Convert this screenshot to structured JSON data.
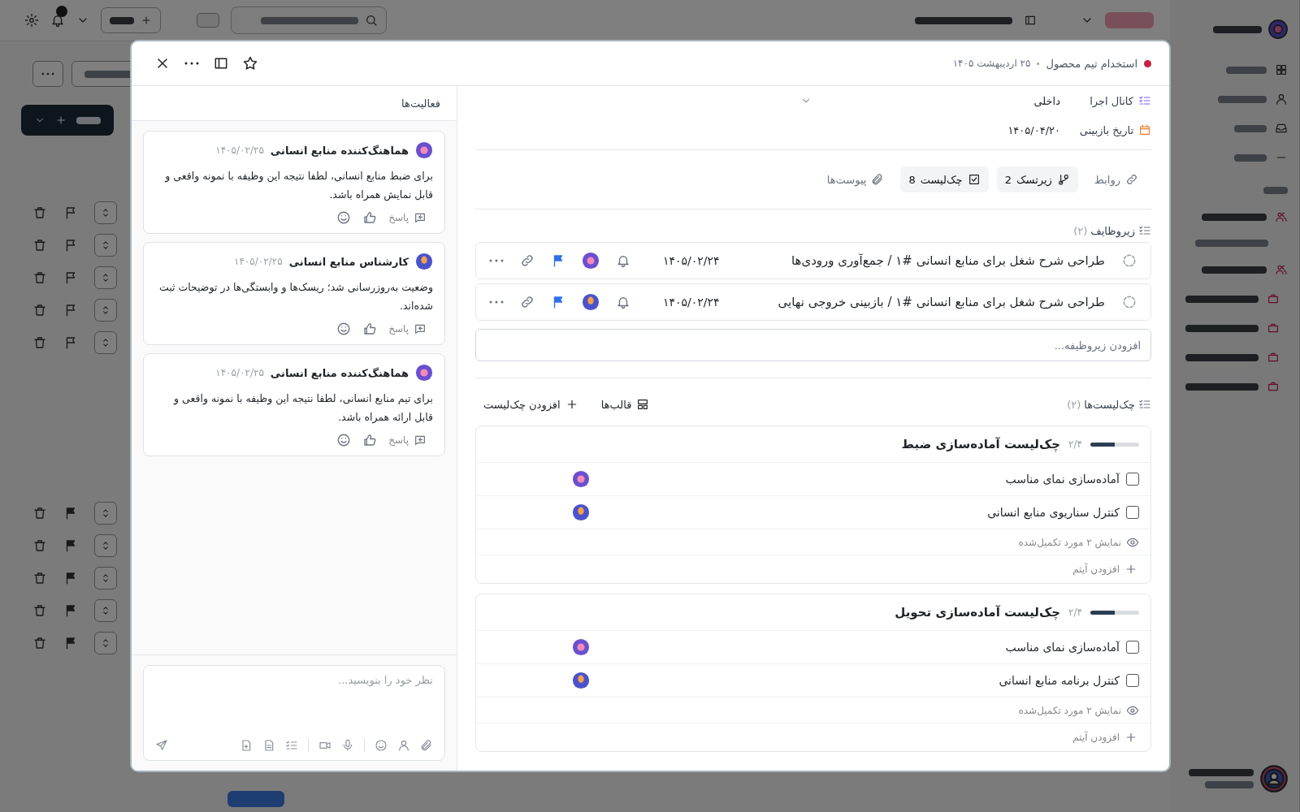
{
  "background": {
    "rows": [
      {
        "flagged": false
      },
      {
        "flagged": false
      },
      {
        "flagged": false
      },
      {
        "flagged": false
      },
      {
        "flagged": false
      },
      {
        "flagged": true
      },
      {
        "flagged": true
      },
      {
        "flagged": true
      },
      {
        "flagged": true
      },
      {
        "flagged": true
      }
    ]
  },
  "modal": {
    "header": {
      "project": "استخدام تیم محصول",
      "date": "۲۵ اردیبهشت ۱۴۰۵"
    },
    "fields": [
      {
        "kind": "channel",
        "label": "کانال اجرا",
        "value": "داخلی"
      },
      {
        "kind": "date",
        "label": "تاریخ بازبینی",
        "value": "۱۴۰۵/۰۴/۲۰"
      }
    ],
    "tabs": [
      {
        "kind": "relations",
        "label": "روابط"
      },
      {
        "kind": "subtasks",
        "label": "زیرتسک",
        "count": "2"
      },
      {
        "kind": "checklist",
        "label": "چک‌لیست",
        "count": "8"
      },
      {
        "kind": "attachments",
        "label": "پیوست‌ها"
      }
    ],
    "subtasks": {
      "title": "زیروظایف",
      "count": "(۲)",
      "add_placeholder": "افزودن زیروظیفه...",
      "items": [
        {
          "title": "طراحی شرح شغل برای منابع انسانی #۱ / جمع‌آوری ورودی‌ها",
          "date": "۱۴۰۵/۰۲/۲۴",
          "flagged": true
        },
        {
          "title": "طراحی شرح شغل برای منابع انسانی #۱ / بازبینی خروجی نهایی",
          "date": "۱۴۰۵/۰۲/۲۴",
          "flagged": true
        }
      ]
    },
    "checklists": {
      "title": "چک‌لیست‌ها",
      "count": "(۲)",
      "templates": "قالب‌ها",
      "add": "افزودن چک‌لیست",
      "lists": [
        {
          "title": "چک‌لیست آماده‌سازی ضبط",
          "progress": "۲/۴",
          "level": 0.5,
          "show_completed": "نمایش ۲ مورد تکمیل‌شده",
          "add_item": "افزودن آیتم",
          "items": [
            {
              "label": "آماده‌سازی نمای مناسب",
              "checked": false
            },
            {
              "label": "کنترل سناریوی منابع انسانی",
              "checked": false
            }
          ]
        },
        {
          "title": "چک‌لیست آماده‌سازی تحویل",
          "progress": "۲/۴",
          "level": 0.5,
          "show_completed": "نمایش ۲ مورد تکمیل‌شده",
          "add_item": "افزودن آیتم",
          "items": [
            {
              "label": "آماده‌سازی نمای مناسب",
              "checked": false
            },
            {
              "label": "کنترل برنامه منابع انسانی",
              "checked": false
            }
          ]
        }
      ]
    },
    "activity": {
      "title": "فعالیت‌ها",
      "composer_placeholder": "نظر خود را بنویسید...",
      "comments": [
        {
          "author": "هماهنگ‌کننده منابع انسانی",
          "date": "۱۴۰۵/۰۲/۲۵",
          "text": "برای ضبط منابع انسانی، لطفا نتیجه این وظیفه با نمونه واقعی و قابل نمایش همراه باشد.",
          "reply": "پاسخ"
        },
        {
          "author": "کارشناس منابع انسانی",
          "date": "۱۴۰۵/۰۲/۲۵",
          "text": "وضعیت به‌روزرسانی شد؛ ریسک‌ها و وابستگی‌ها در توضیحات ثبت شده‌اند.",
          "reply": "پاسخ"
        },
        {
          "author": "هماهنگ‌کننده منابع انسانی",
          "date": "۱۴۰۵/۰۲/۲۵",
          "text": "برای تیم منابع انسانی، لطفا نتیجه این وظیفه با نمونه واقعی و قابل ارائه همراه باشد.",
          "reply": "پاسخ"
        }
      ]
    }
  }
}
